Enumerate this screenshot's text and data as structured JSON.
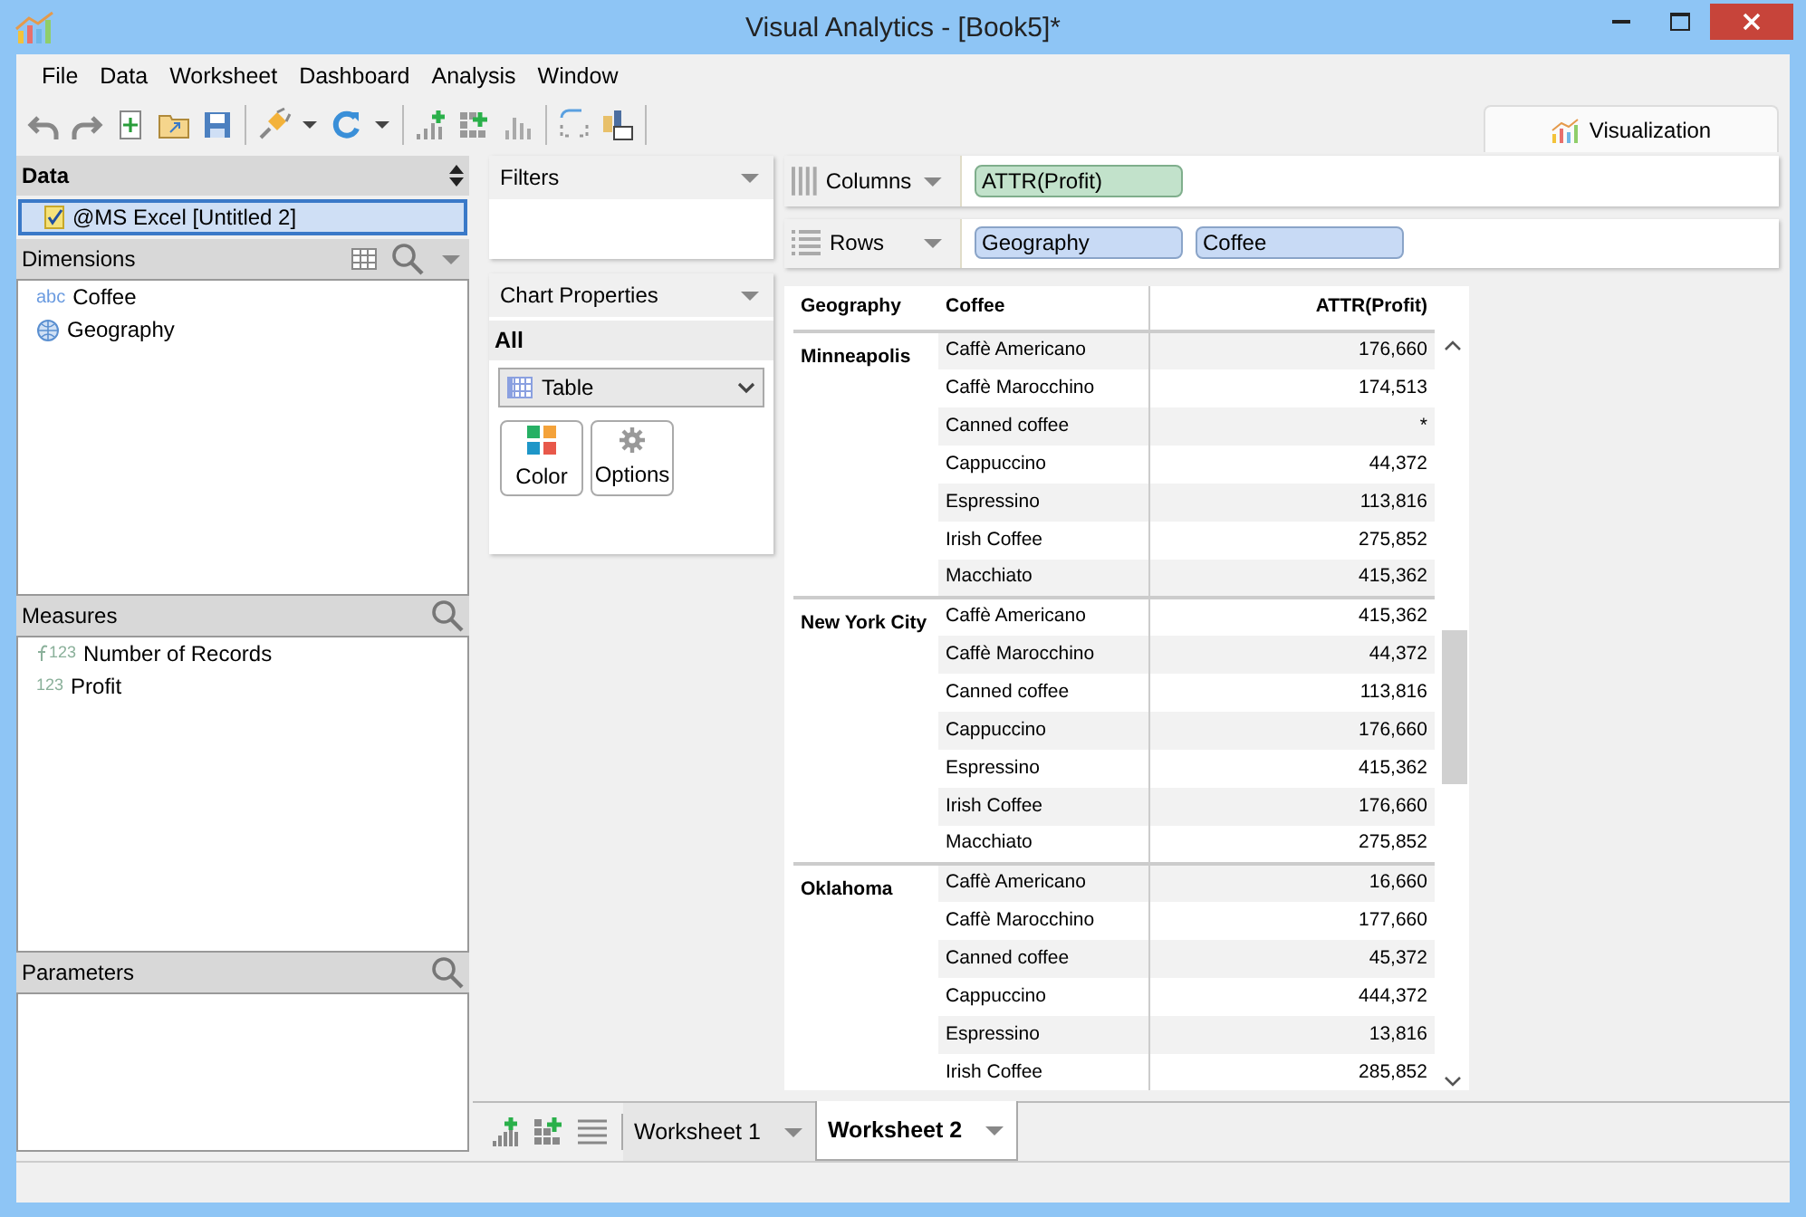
{
  "window": {
    "title": "Visual Analytics - [Book5]*"
  },
  "menu": [
    "File",
    "Data",
    "Worksheet",
    "Dashboard",
    "Analysis",
    "Window"
  ],
  "side_tab": {
    "label": "Visualization",
    "selected": true
  },
  "data_panel": {
    "title": "Data",
    "sources": [
      {
        "label": "@MS Excel [Untitled 2]",
        "selected": true
      }
    ]
  },
  "dimensions": {
    "title": "Dimensions",
    "items": [
      {
        "kind": "text",
        "type_label": "abc",
        "label": "Coffee"
      },
      {
        "kind": "geo",
        "label": "Geography"
      }
    ]
  },
  "measures": {
    "title": "Measures",
    "items": [
      {
        "kind": "calc",
        "type_label": "123",
        "label": "Number of Records"
      },
      {
        "kind": "number",
        "type_label": "123",
        "label": "Profit"
      }
    ]
  },
  "parameters": {
    "title": "Parameters"
  },
  "filters": {
    "title": "Filters"
  },
  "chart_properties": {
    "title": "Chart Properties",
    "mark_group": "All",
    "chart_type": "Table",
    "buttons": [
      {
        "kind": "color",
        "label": "Color"
      },
      {
        "kind": "options",
        "label": "Options"
      }
    ]
  },
  "shelves": [
    {
      "kind": "columns",
      "label": "Columns",
      "pills": [
        {
          "kind": "measure",
          "label": "ATTR(Profit)"
        }
      ]
    },
    {
      "kind": "rows",
      "label": "Rows",
      "pills": [
        {
          "kind": "dimension",
          "label": "Geography"
        },
        {
          "kind": "dimension",
          "label": "Coffee"
        }
      ]
    }
  ],
  "table": {
    "columns": [
      "Geography",
      "Coffee",
      "ATTR(Profit)"
    ],
    "groups": [
      {
        "geography": "Minneapolis",
        "rows": [
          [
            "Caffè Americano",
            "176,660"
          ],
          [
            "Caffè Marocchino",
            "174,513"
          ],
          [
            "Canned coffee",
            "*"
          ],
          [
            "Cappuccino",
            "44,372"
          ],
          [
            "Espressino",
            "113,816"
          ],
          [
            "Irish Coffee",
            "275,852"
          ],
          [
            "Macchiato",
            "415,362"
          ]
        ]
      },
      {
        "geography": "New York City",
        "rows": [
          [
            "Caffè Americano",
            "415,362"
          ],
          [
            "Caffè Marocchino",
            "44,372"
          ],
          [
            "Canned coffee",
            "113,816"
          ],
          [
            "Cappuccino",
            "176,660"
          ],
          [
            "Espressino",
            "415,362"
          ],
          [
            "Irish Coffee",
            "176,660"
          ],
          [
            "Macchiato",
            "275,852"
          ]
        ]
      },
      {
        "geography": "Oklahoma",
        "rows": [
          [
            "Caffè Americano",
            "16,660"
          ],
          [
            "Caffè Marocchino",
            "177,660"
          ],
          [
            "Canned coffee",
            "45,372"
          ],
          [
            "Cappuccino",
            "444,372"
          ],
          [
            "Espressino",
            "13,816"
          ],
          [
            "Irish Coffee",
            "285,852"
          ]
        ]
      }
    ]
  },
  "sheets": [
    {
      "label": "Worksheet 1",
      "selected": false
    },
    {
      "label": "Worksheet 2",
      "selected": true
    }
  ]
}
